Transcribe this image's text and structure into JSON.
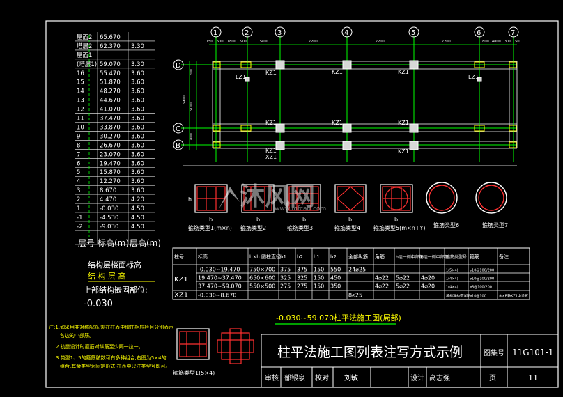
{
  "colors": {
    "background": "#000000",
    "grid": "#00ff00",
    "text": "#ffffff",
    "section": "#ff3030",
    "highlight": "#ffff00",
    "frame": "#ffffff"
  },
  "floor_table": {
    "rows": [
      [
        "屋面2",
        "65.670",
        ""
      ],
      [
        "塔层2",
        "62.370",
        "3.30"
      ],
      [
        "屋面1",
        "",
        ""
      ],
      [
        "(塔层1)",
        "59.070",
        "3.30"
      ],
      [
        "16",
        "55.470",
        "3.60"
      ],
      [
        "15",
        "51.870",
        "3.60"
      ],
      [
        "14",
        "48.270",
        "3.60"
      ],
      [
        "13",
        "44.670",
        "3.60"
      ],
      [
        "12",
        "41.070",
        "3.60"
      ],
      [
        "11",
        "37.470",
        "3.60"
      ],
      [
        "10",
        "33.870",
        "3.60"
      ],
      [
        "9",
        "30.270",
        "3.60"
      ],
      [
        "8",
        "26.670",
        "3.60"
      ],
      [
        "7",
        "23.070",
        "3.60"
      ],
      [
        "6",
        "19.470",
        "3.60"
      ],
      [
        "5",
        "15.870",
        "3.60"
      ],
      [
        "4",
        "12.270",
        "3.60"
      ],
      [
        "3",
        "8.670",
        "3.60"
      ],
      [
        "2",
        "4.470",
        "4.20"
      ],
      [
        "1",
        "-0.030",
        "4.50"
      ],
      [
        "-1",
        "-4.530",
        "4.50"
      ],
      [
        "-2",
        "-9.030",
        "4.50"
      ]
    ],
    "header": [
      "层号",
      "标高(m)",
      "层高(m)"
    ],
    "caption1": "结构层楼面标高",
    "caption2": "结 构 层 高",
    "embed_label": "上部结构嵌固部位:",
    "embed_value": "-0.030"
  },
  "plan": {
    "axes_top": [
      "1",
      "2",
      "3",
      "4",
      "5",
      "6",
      "7"
    ],
    "axes_left": [
      "D",
      "C",
      "B"
    ],
    "dims_top": [
      "150",
      "600",
      "1800",
      "900",
      "3400",
      "7200",
      "7200",
      "7200",
      "1800",
      "4800",
      "300",
      "150"
    ],
    "dims_left": [
      "1700",
      "6900",
      "5100",
      "1800"
    ],
    "labels": [
      "LZ1",
      "KZ1",
      "KZ1",
      "KZ1",
      "LZ1",
      "KZ1",
      "KZ1",
      "KZ1",
      "KZ1",
      "KZ1",
      "XZ1"
    ]
  },
  "sections": [
    {
      "label": "箍筋类型1(m×n)"
    },
    {
      "label": "箍筋类型2"
    },
    {
      "label": "箍筋类型3"
    },
    {
      "label": "箍筋类型4"
    },
    {
      "label": "箍筋类型5(m×n+Y)"
    },
    {
      "label": "箍筋类型6"
    },
    {
      "label": "箍筋类型7"
    }
  ],
  "section_dim": "b",
  "section_h": "h",
  "watermark": {
    "brand": "沐风网",
    "url": "www.mfcad.com"
  },
  "schedule": {
    "headers": [
      "柱号",
      "标高",
      "b×h 圆柱直径",
      "b1",
      "b2",
      "h1",
      "h2",
      "全部纵筋",
      "角筋",
      "b边一侧中部筋",
      "h边一侧中部筋",
      "箍筋类型号",
      "箍筋",
      "备注"
    ],
    "rows": [
      [
        "KZ1",
        "-0.030~19.470",
        "750×700",
        "375",
        "375",
        "150",
        "550",
        "24⌀25",
        "",
        "",
        "",
        "1(5×4)",
        "⌀10@100/200",
        ""
      ],
      [
        "",
        "19.470~37.470",
        "650×600",
        "325",
        "325",
        "150",
        "450",
        "",
        "4⌀22",
        "5⌀22",
        "4⌀20",
        "1(4×4)",
        "⌀10@100/200",
        "—"
      ],
      [
        "",
        "37.470~59.070",
        "550×500",
        "275",
        "275",
        "150",
        "350",
        "",
        "4⌀22",
        "5⌀22",
        "4⌀20",
        "1(4×4)",
        "⌀8@100/200",
        ""
      ],
      [
        "XZ1",
        "-0.030~8.670",
        "",
        "",
        "",
        "",
        "",
        "8⌀25",
        "",
        "",
        "",
        "按标准构造详图",
        "⌀10@100",
        "③×B轴KZ1中设置"
      ]
    ],
    "title": "-0.030~59.070柱平法施工图(局部)"
  },
  "notes": [
    "注:1.如采用非对称配筋,需在柱表中增加相应栏目分别表示",
    "各边的中部筋。",
    "2.抗震设计时箍筋对纵筋至少隔一拉一。",
    "3.类型1、5的箍筋肢数可有多种组合,右图为5×4的",
    "组合,其余类型为固定形式,在表中只注类型号即可。"
  ],
  "note_section_label": "箍筋类型1(5×4)",
  "title_block": {
    "title": "柱平法施工图列表注写方式示例",
    "atlas_label": "图集号",
    "atlas_no": "11G101-1",
    "review_label": "审核",
    "review_name": "郁银泉",
    "check_label": "校对",
    "check_name": "刘敏",
    "design_label": "设计",
    "design_name": "高志强",
    "page_label": "页",
    "page_no": "11"
  }
}
